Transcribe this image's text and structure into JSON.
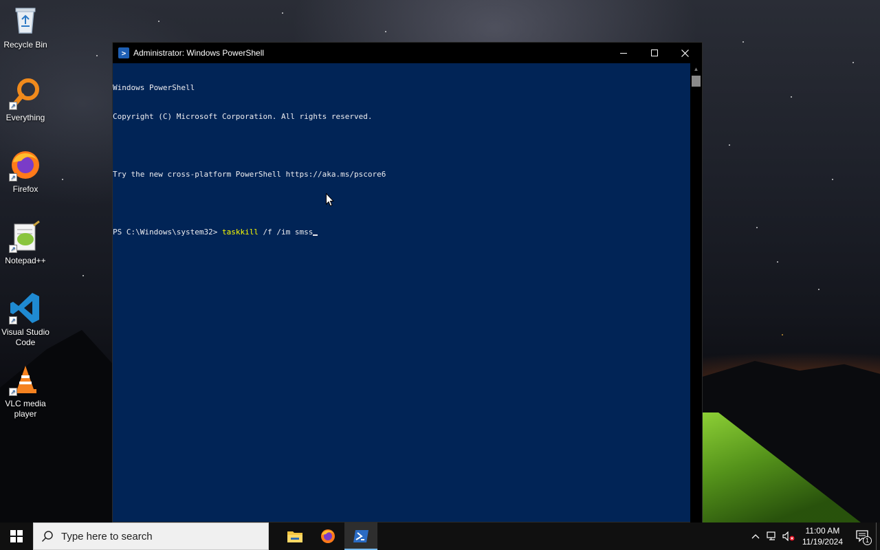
{
  "desktop": {
    "icons": [
      {
        "label": "Recycle Bin"
      },
      {
        "label": "Everything"
      },
      {
        "label": "Firefox"
      },
      {
        "label": "Notepad++"
      },
      {
        "label": "Visual Studio Code"
      },
      {
        "label": "VLC media player"
      }
    ]
  },
  "window": {
    "title": "Administrator: Windows PowerShell",
    "console": {
      "line1": "Windows PowerShell",
      "line2": "Copyright (C) Microsoft Corporation. All rights reserved.",
      "line4": "Try the new cross-platform PowerShell https://aka.ms/pscore6",
      "prompt": "PS C:\\Windows\\system32> ",
      "command": "taskkill",
      "args": " /f /im smss"
    },
    "colors": {
      "background": "#012456",
      "text": "#eeedf0",
      "command": "#ffff00"
    }
  },
  "taskbar": {
    "search_placeholder": "Type here to search",
    "apps": [
      "file-explorer",
      "firefox",
      "powershell"
    ],
    "time": "11:00 AM",
    "date": "11/19/2024",
    "notification_count": "1"
  }
}
